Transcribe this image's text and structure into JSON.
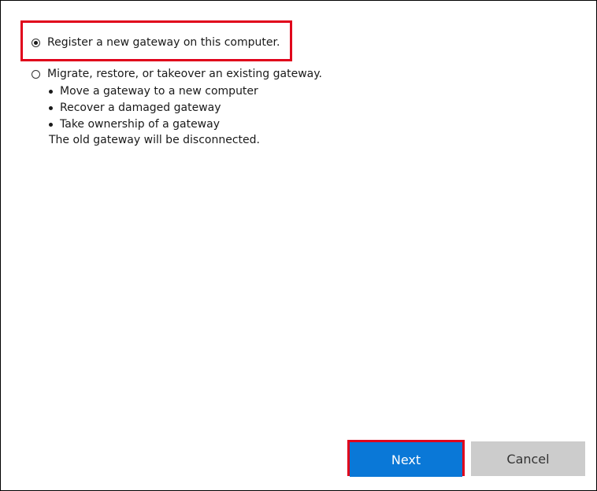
{
  "options": {
    "register": {
      "label": "Register a new gateway on this computer.",
      "selected": true
    },
    "migrate": {
      "label": "Migrate, restore, or takeover an existing gateway.",
      "selected": false,
      "bullets": [
        "Move a gateway to a new computer",
        "Recover a damaged gateway",
        "Take ownership of a gateway"
      ],
      "note": "The old gateway will be disconnected."
    }
  },
  "buttons": {
    "next_label": "Next",
    "cancel_label": "Cancel"
  },
  "colors": {
    "primary": "#0a78d7",
    "secondary": "#cccccc",
    "highlight": "#e0001b"
  }
}
